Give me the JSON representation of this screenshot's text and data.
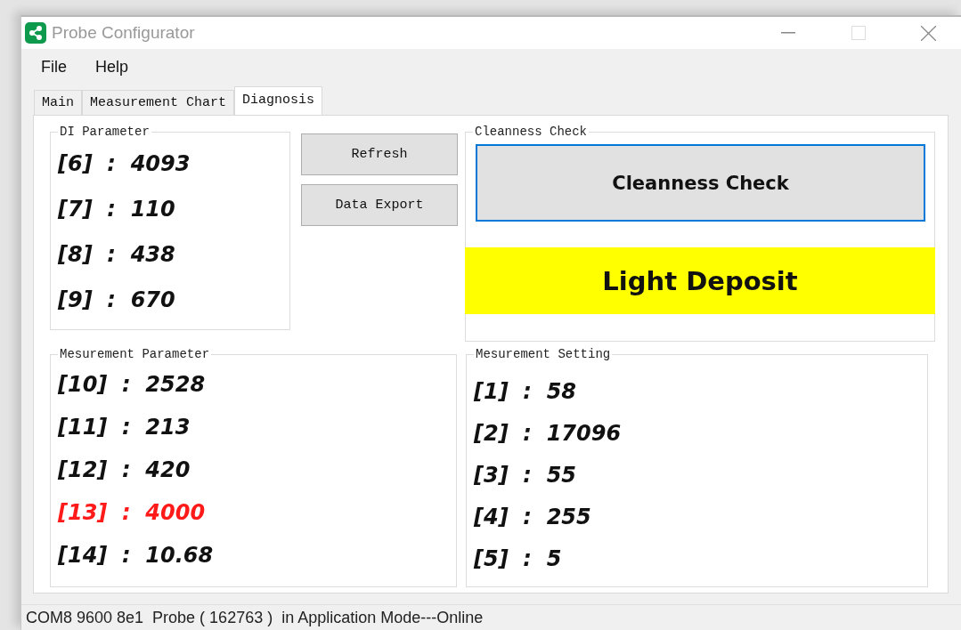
{
  "window": {
    "title": "Probe Configurator"
  },
  "menu": [
    {
      "label": "File"
    },
    {
      "label": "Help"
    }
  ],
  "tabs": [
    {
      "label": "Main",
      "selected": false
    },
    {
      "label": "Measurement Chart",
      "selected": false
    },
    {
      "label": "Diagnosis",
      "selected": true
    }
  ],
  "di_parameter": {
    "title": "DI Parameter",
    "rows": [
      {
        "text": "[6]  :  4093",
        "alert": false
      },
      {
        "text": "[7]  :  110",
        "alert": false
      },
      {
        "text": "[8]  :  438",
        "alert": false
      },
      {
        "text": "[9]  :  670",
        "alert": false
      }
    ]
  },
  "buttons": [
    {
      "label": "Refresh"
    },
    {
      "label": "Data Export"
    }
  ],
  "cleanness_check": {
    "title": "Cleanness Check",
    "button": "Cleanness Check",
    "result": "Light Deposit"
  },
  "measurement_parameter": {
    "title": "Mesurement Parameter",
    "rows": [
      {
        "text": "[10]  :  2528",
        "alert": false
      },
      {
        "text": "[11]  :  213",
        "alert": false
      },
      {
        "text": "[12]  :  420",
        "alert": false
      },
      {
        "text": "[13]  :  4000",
        "alert": true
      },
      {
        "text": "[14]  :  10.68",
        "alert": false
      }
    ]
  },
  "measurement_setting": {
    "title": "Mesurement Setting",
    "rows": [
      {
        "text": "[1]  :  58",
        "alert": false
      },
      {
        "text": "[2]  :  17096",
        "alert": false
      },
      {
        "text": "[3]  :  55",
        "alert": false
      },
      {
        "text": "[4]  :  255",
        "alert": false
      },
      {
        "text": "[5]  :  5",
        "alert": false
      }
    ]
  },
  "status_bar": {
    "text": "COM8 9600 8e1  Probe ( 162763 )  in Application Mode---Online"
  }
}
